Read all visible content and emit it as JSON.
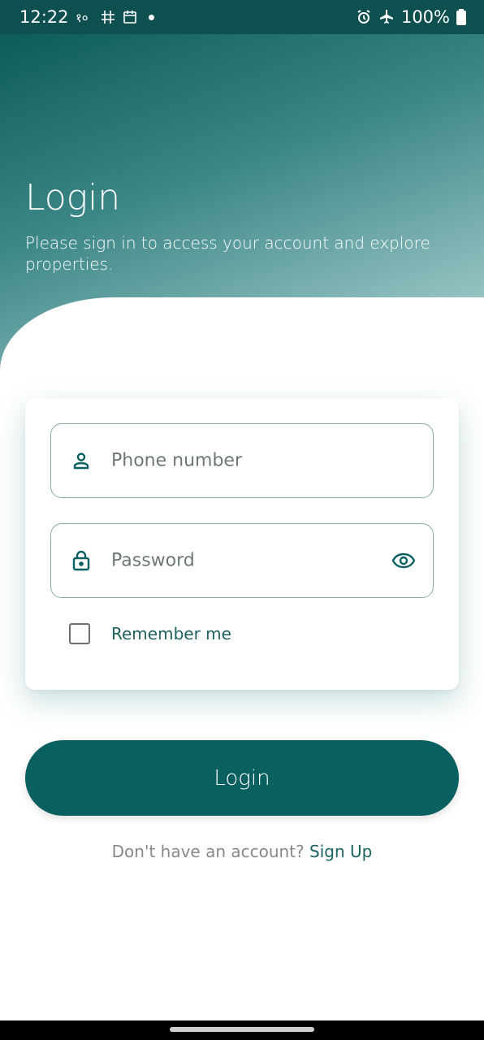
{
  "status_bar": {
    "time": "12:22",
    "battery": "100%",
    "left_icons": [
      "notification-icon",
      "grid-icon",
      "calendar-icon",
      "dot-indicator"
    ],
    "right_icons": [
      "alarm-icon",
      "airplane-icon",
      "battery-icon"
    ]
  },
  "header": {
    "title": "Login",
    "subtitle": "Please sign in to access your account and explore properties."
  },
  "form": {
    "phone_placeholder": "Phone number",
    "password_placeholder": "Password",
    "remember_label": "Remember me"
  },
  "actions": {
    "login_label": "Login",
    "signup_prompt": "Don't have an account?",
    "signup_link": "Sign Up"
  },
  "colors": {
    "primary": "#0a6060",
    "field_border": "#86aaaa",
    "accent_text": "#1f5f5f"
  }
}
